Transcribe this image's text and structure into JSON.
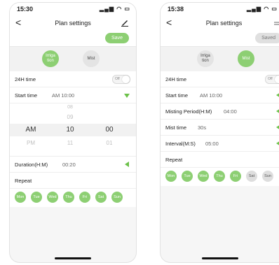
{
  "left": {
    "status_time": "15:30",
    "status_icons": "▂▄▆ ◠ ▭",
    "nav": {
      "back": "<",
      "title": "Plan settings",
      "edit_icon": "pencil-icon"
    },
    "save_label": "Save",
    "modes": [
      "Irriga tion",
      "Mist"
    ],
    "rows": {
      "time24_label": "24H time",
      "time24_toggle": "Off",
      "start_label": "Start time",
      "start_value": "AM 10:00",
      "duration_label": "Duration(H:M)",
      "duration_value": "00:20",
      "repeat_label": "Repeat"
    },
    "picker": {
      "col1": [
        "",
        "",
        "AM",
        "PM"
      ],
      "col2": [
        "08",
        "09",
        "10",
        "11"
      ],
      "col3": [
        "",
        "",
        "00",
        "01"
      ]
    },
    "days": [
      "Mon",
      "Tue",
      "Wed",
      "Thu",
      "Fri",
      "Sat",
      "Sun"
    ]
  },
  "right": {
    "status_time": "15:38",
    "status_icons": "▂▄▆ ◠ ▭",
    "nav": {
      "back": "<",
      "title": "Plan settings",
      "edit_icon": "pencil-icon"
    },
    "saved_label": "Saved",
    "modes": [
      "Irriga tion",
      "Mist"
    ],
    "rows": {
      "time24_label": "24H time",
      "time24_toggle": "Off",
      "start_label": "Start time",
      "start_value": "AM 10:00",
      "misting_label": "Misting Period(H:M)",
      "misting_value": "04:00",
      "mist_label": "Mist time",
      "mist_value": "30s",
      "interval_label": "Interval(M:S)",
      "interval_value": "05:00",
      "repeat_label": "Repeat"
    },
    "days": [
      "Mon",
      "Tue",
      "Wed",
      "Thu",
      "Fri",
      "Sat",
      "Sun"
    ],
    "days_on": [
      true,
      true,
      true,
      true,
      true,
      false,
      false
    ]
  },
  "colors": {
    "accent": "#8dcf73",
    "indicator": "#6cc14a"
  }
}
